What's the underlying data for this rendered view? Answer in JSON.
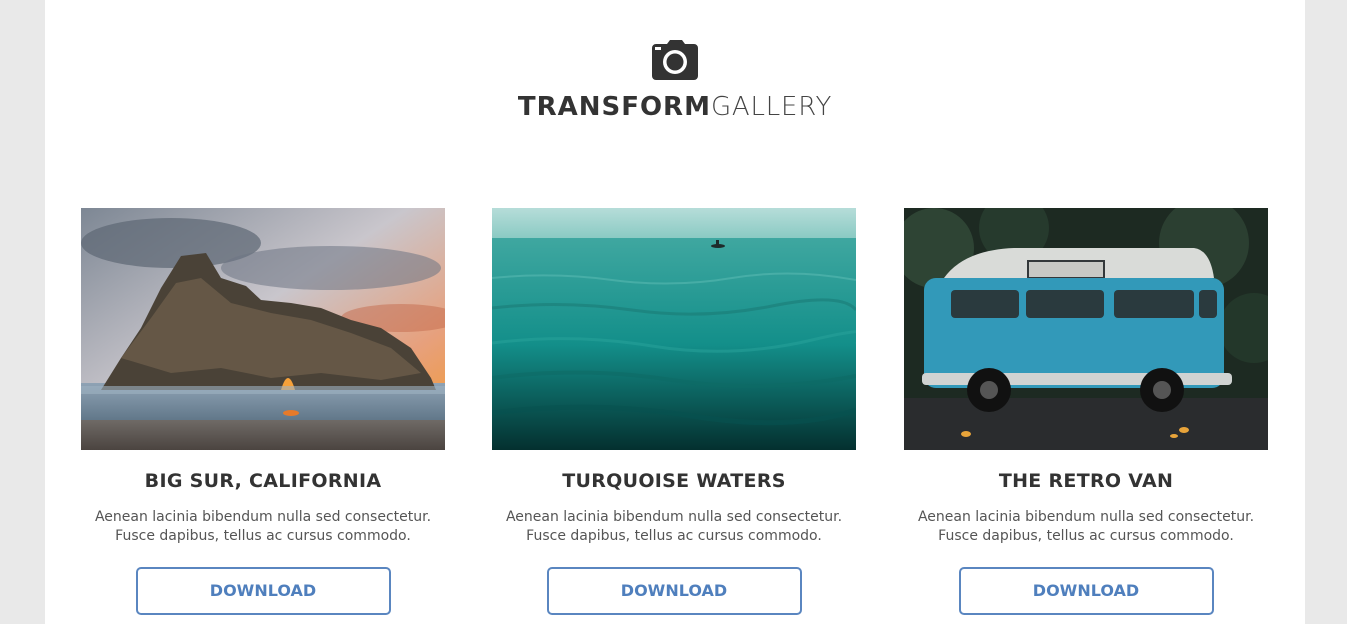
{
  "header": {
    "icon": "camera-icon",
    "brand_strong": "TRANSFORM",
    "brand_light": "GALLERY"
  },
  "cards": [
    {
      "image": "big-sur-rock-arch-photo",
      "title": "BIG SUR, CALIFORNIA",
      "description": "Aenean lacinia bibendum nulla sed consectetur. Fusce dapibus, tellus ac cursus commodo.",
      "button_label": "DOWNLOAD"
    },
    {
      "image": "turquoise-sea-photo",
      "title": "TURQUOISE WATERS",
      "description": "Aenean lacinia bibendum nulla sed consectetur. Fusce dapibus, tellus ac cursus commodo.",
      "button_label": "DOWNLOAD"
    },
    {
      "image": "blue-retro-van-photo",
      "title": "THE RETRO VAN",
      "description": "Aenean lacinia bibendum nulla sed consectetur. Fusce dapibus, tellus ac cursus commodo.",
      "button_label": "DOWNLOAD"
    }
  ],
  "colors": {
    "background": "#e9e9e9",
    "panel": "#ffffff",
    "accent": "#5a86c0",
    "text": "#333333"
  }
}
